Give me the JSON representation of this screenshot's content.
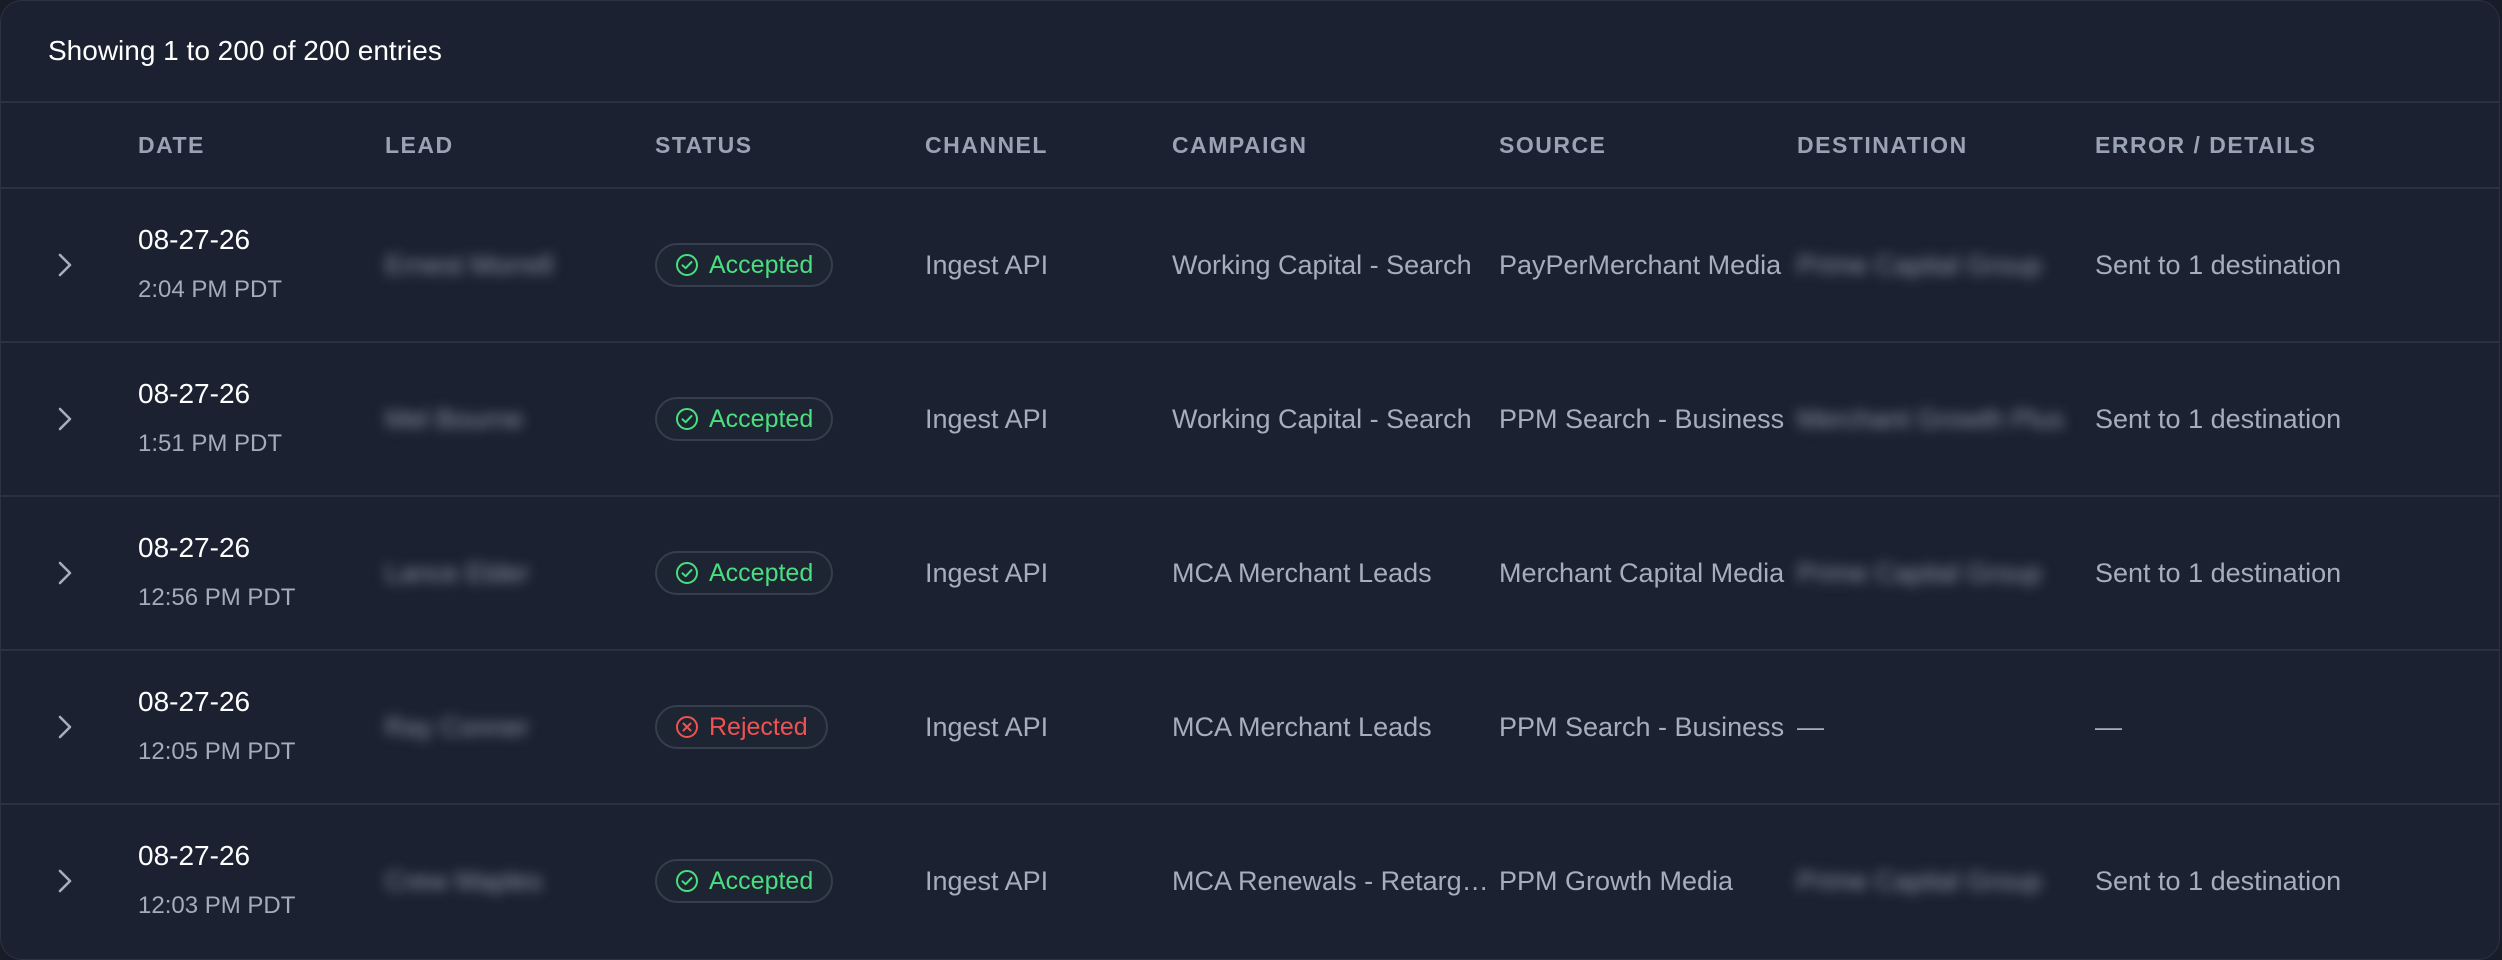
{
  "summary": "Showing 1 to 200 of 200 entries",
  "columns": [
    "DATE",
    "LEAD",
    "STATUS",
    "CHANNEL",
    "CAMPAIGN",
    "SOURCE",
    "DESTINATION",
    "ERROR / DETAILS"
  ],
  "colors": {
    "background": "#1b2130",
    "accepted": "#4ade80",
    "rejected": "#f05252",
    "muted_text": "#a6aebc"
  },
  "rows": [
    {
      "date": "08-27-26",
      "time": "2:04 PM PDT",
      "lead": "Ernest Morrell",
      "status": "Accepted",
      "status_icon": "check-circle-icon",
      "channel": "Ingest API",
      "campaign": "Working Capital - Search",
      "source": "PayPerMerchant Media",
      "destination": "Prime Capital Group",
      "details": "Sent to 1 destination"
    },
    {
      "date": "08-27-26",
      "time": "1:51 PM PDT",
      "lead": "Mel Bourne",
      "status": "Accepted",
      "status_icon": "check-circle-icon",
      "channel": "Ingest API",
      "campaign": "Working Capital - Search",
      "source": "PPM Search - Business",
      "destination": "Merchant Growth Plus",
      "details": "Sent to 1 destination"
    },
    {
      "date": "08-27-26",
      "time": "12:56 PM PDT",
      "lead": "Lance Elder",
      "status": "Accepted",
      "status_icon": "check-circle-icon",
      "channel": "Ingest API",
      "campaign": "MCA Merchant Leads",
      "source": "Merchant Capital Media",
      "destination": "Prime Capital Group",
      "details": "Sent to 1 destination"
    },
    {
      "date": "08-27-26",
      "time": "12:05 PM PDT",
      "lead": "Ray Conner",
      "status": "Rejected",
      "status_icon": "x-circle-icon",
      "channel": "Ingest API",
      "campaign": "MCA Merchant Leads",
      "source": "PPM Search - Business",
      "destination": "—",
      "details": "—"
    },
    {
      "date": "08-27-26",
      "time": "12:03 PM PDT",
      "lead": "Crew Maples",
      "status": "Accepted",
      "status_icon": "check-circle-icon",
      "channel": "Ingest API",
      "campaign": "MCA Renewals - Retargeting",
      "source": "PPM Growth Media",
      "destination": "Prime Capital Group",
      "details": "Sent to 1 destination"
    }
  ]
}
